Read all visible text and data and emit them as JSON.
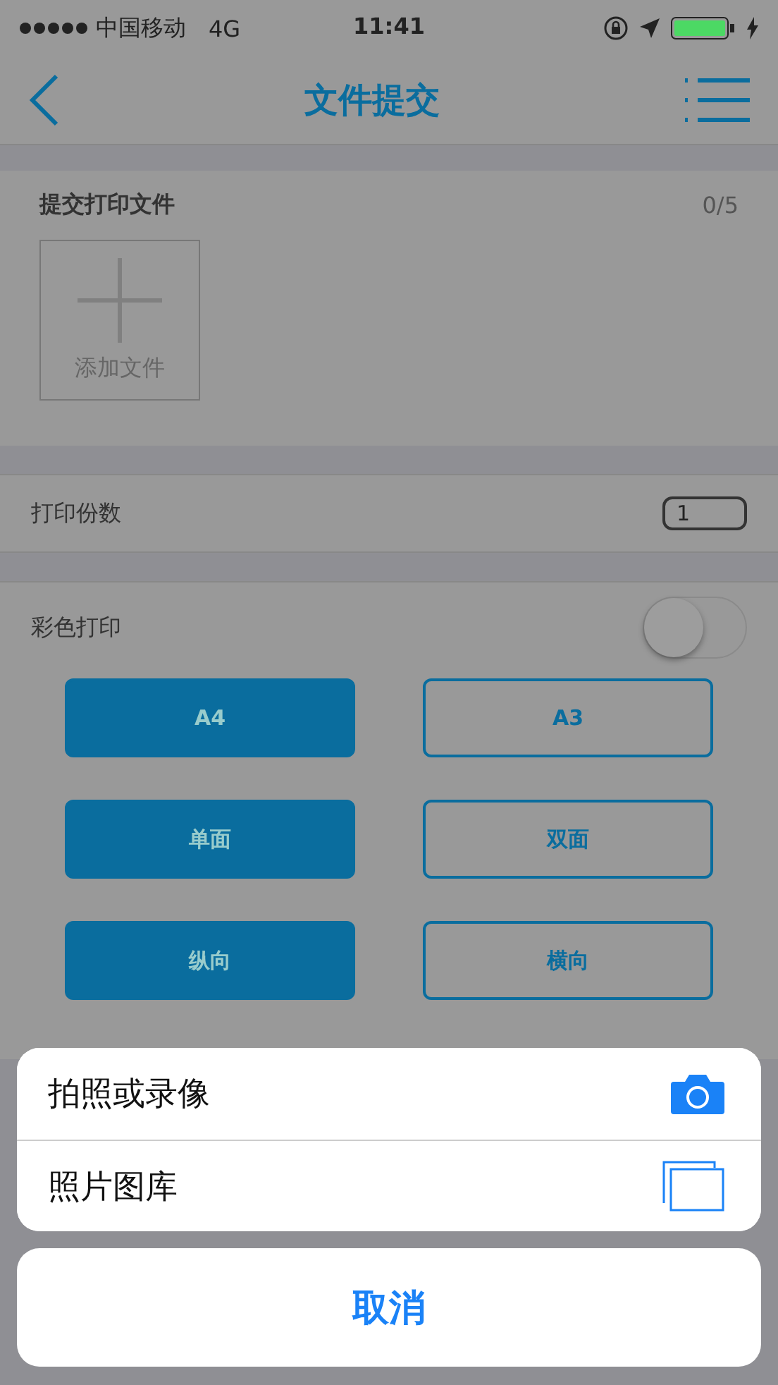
{
  "status_bar": {
    "carrier": "中国移动",
    "network": "4G",
    "time": "11:41"
  },
  "nav": {
    "title": "文件提交"
  },
  "upload": {
    "title": "提交打印文件",
    "count": "0/5",
    "add_label": "添加文件"
  },
  "copies": {
    "label": "打印份数",
    "value": "1"
  },
  "color_print": {
    "label": "彩色打印",
    "on": false
  },
  "option_rows": [
    {
      "choices": [
        {
          "label": "A4",
          "selected": true
        },
        {
          "label": "A3",
          "selected": false
        }
      ]
    },
    {
      "choices": [
        {
          "label": "单面",
          "selected": true
        },
        {
          "label": "双面",
          "selected": false
        }
      ]
    },
    {
      "choices": [
        {
          "label": "纵向",
          "selected": true
        },
        {
          "label": "横向",
          "selected": false
        }
      ]
    }
  ],
  "action_sheet": {
    "actions": [
      {
        "label": "拍照或录像",
        "kind": "camera"
      },
      {
        "label": "照片图库",
        "kind": "library"
      }
    ],
    "cancel": "取消"
  }
}
